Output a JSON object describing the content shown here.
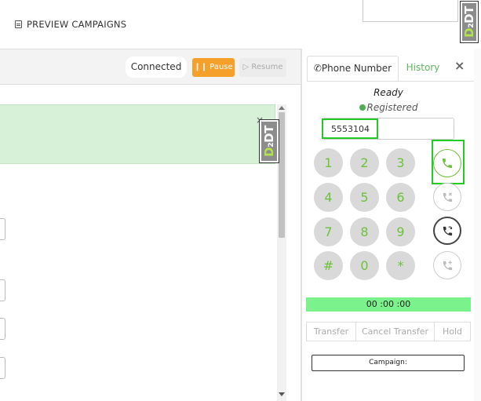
{
  "header": {
    "preview_campaigns_label": "PREVIEW CAMPAIGNS",
    "logo_text_d": "D",
    "logo_text_rest": "₂DT"
  },
  "left_panel": {
    "connected_label": "Connected",
    "pause_label": "Pause",
    "resume_label": "Resume",
    "alert_close": "×"
  },
  "phone": {
    "tab_phone_label": "Phone Number",
    "tab_history_label": "History",
    "close_label": "×",
    "status_text": "Ready",
    "registered_text": "Registered",
    "number_value": "5553104",
    "keys": [
      "1",
      "2",
      "3",
      "4",
      "5",
      "6",
      "7",
      "8",
      "9",
      "#",
      "0",
      "*"
    ],
    "timer": "00 :00 :00",
    "transfer_label": "Transfer",
    "cancel_transfer_label": "Cancel Transfer",
    "hold_label": "Hold",
    "campaign_label": "Campaign:"
  },
  "colors": {
    "accent_green": "#6cc23a",
    "pause_orange": "#f5a02b",
    "timer_green": "#7bf28b",
    "alert_green": "#d6f1d8"
  }
}
